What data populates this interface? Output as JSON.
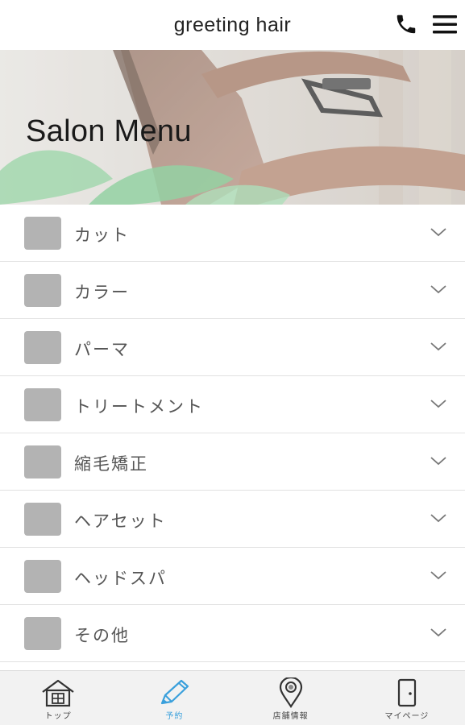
{
  "header": {
    "title": "greeting hair",
    "phone_icon": "phone-icon",
    "menu_icon": "hamburger-menu-icon"
  },
  "hero": {
    "title": "Salon Menu"
  },
  "menu": {
    "items": [
      {
        "label": "カット"
      },
      {
        "label": "カラー"
      },
      {
        "label": "パーマ"
      },
      {
        "label": "トリートメント"
      },
      {
        "label": "縮毛矯正"
      },
      {
        "label": "ヘアセット"
      },
      {
        "label": "ヘッドスパ"
      },
      {
        "label": "その他"
      }
    ]
  },
  "tabbar": {
    "tabs": [
      {
        "label": "トップ",
        "icon": "home-icon",
        "active": false
      },
      {
        "label": "予約",
        "icon": "pencil-icon",
        "active": true
      },
      {
        "label": "店舗情報",
        "icon": "map-pin-icon",
        "active": false
      },
      {
        "label": "マイページ",
        "icon": "door-icon",
        "active": false
      }
    ]
  },
  "colors": {
    "accent": "#3aa0dc",
    "thumb_placeholder": "#b3b3b3"
  }
}
